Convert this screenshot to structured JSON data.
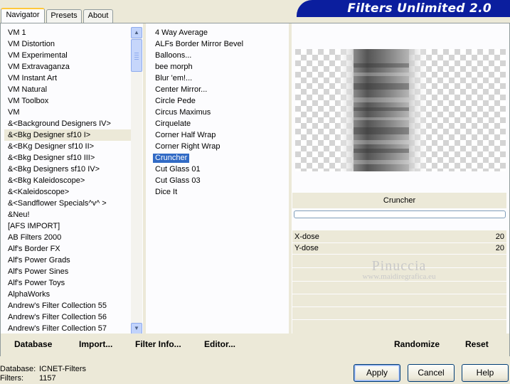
{
  "tabs": [
    "Navigator",
    "Presets",
    "About"
  ],
  "banner_title": "Filters Unlimited 2.0",
  "categories": [
    "VM 1",
    "VM Distortion",
    "VM Experimental",
    "VM Extravaganza",
    "VM Instant Art",
    "VM Natural",
    "VM Toolbox",
    "VM",
    "&<Background Designers IV>",
    "&<Bkg Designer sf10 I>",
    "&<BKg Designer sf10 II>",
    "&<Bkg Designer sf10 III>",
    "&<Bkg Designers sf10 IV>",
    "&<Bkg Kaleidoscope>",
    "&<Kaleidoscope>",
    "&<Sandflower Specials^v^ >",
    "&Neu!",
    "[AFS IMPORT]",
    "AB Filters 2000",
    "Alf's Border FX",
    "Alf's Power Grads",
    "Alf's Power Sines",
    "Alf's Power Toys",
    "AlphaWorks",
    "Andrew's Filter Collection 55",
    "Andrew's Filter Collection 56",
    "Andrew's Filter Collection 57"
  ],
  "selected_category": "&<Bkg Designer sf10 I>",
  "filters": [
    "4 Way Average",
    "ALFs Border Mirror Bevel",
    "Balloons...",
    "bee morph",
    "Blur 'em!...",
    "Center Mirror...",
    "Circle Pede",
    "Circus Maximus",
    "Cirquelate",
    "Corner Half Wrap",
    "Corner Right Wrap",
    "Cruncher",
    "Cut Glass 01",
    "Cut Glass 03",
    "Dice It"
  ],
  "selected_filter": "Cruncher",
  "preview": {
    "filter_name": "Cruncher",
    "progress": 0.0
  },
  "params": [
    {
      "label": "X-dose",
      "value": "20"
    },
    {
      "label": "Y-dose",
      "value": "20"
    }
  ],
  "watermark": {
    "line1": "Pinuccia",
    "line2": "www.maidiregrafica.eu"
  },
  "links": {
    "database": "Database",
    "import": "Import...",
    "filter_info": "Filter Info...",
    "editor": "Editor...",
    "randomize": "Randomize",
    "reset": "Reset"
  },
  "footer": {
    "database_label": "Database:",
    "database_value": "ICNET-Filters",
    "filters_label": "Filters:",
    "filters_value": "1157"
  },
  "buttons": {
    "apply": "Apply",
    "cancel": "Cancel",
    "help": "Help"
  },
  "colors": {
    "banner": "#0b1e9e",
    "selection": "#316ac5",
    "dialog_bg": "#ece9d8"
  }
}
